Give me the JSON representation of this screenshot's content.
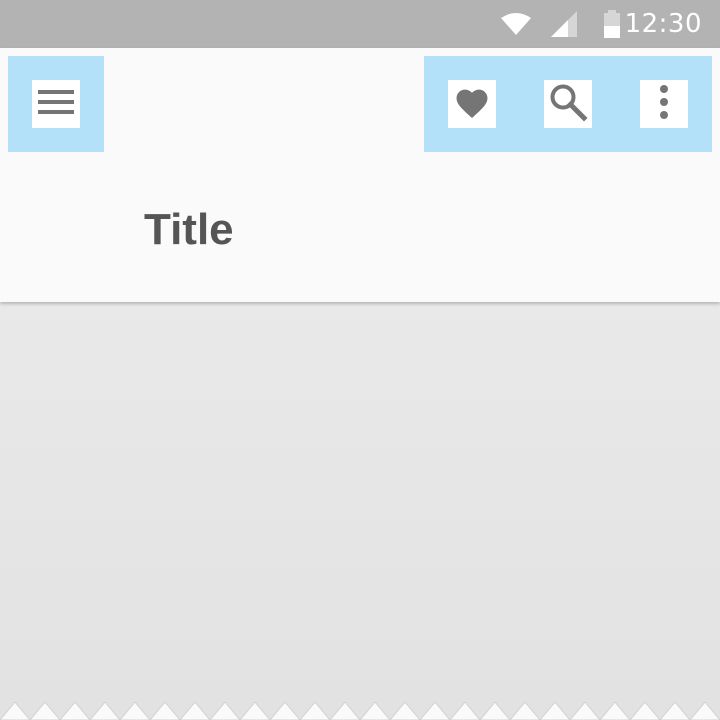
{
  "status_bar": {
    "time": "12:30",
    "icons": [
      "wifi-icon",
      "cell-signal-icon",
      "battery-icon"
    ]
  },
  "app_bar": {
    "title": "Title",
    "navigation_icon": "menu-icon",
    "action_icons": [
      "heart-icon",
      "search-icon",
      "more-vert-icon"
    ]
  },
  "colors": {
    "status_bar_bg": "#b3b3b3",
    "app_bar_bg": "#fafafa",
    "highlight": "#b2e1f9",
    "icon_fg": "#757575",
    "title_text": "#555555",
    "content_bg": "#e6e6e6"
  }
}
